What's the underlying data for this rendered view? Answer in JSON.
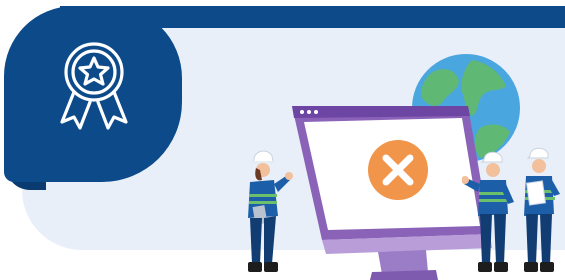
{
  "illustration": {
    "badge_icon": "award-ribbon-star-icon",
    "status_icon": "close-x-icon",
    "colors": {
      "navy": "#0c4a8a",
      "panel": "#e9eff8",
      "monitor": "#8a62b8",
      "error": "#f0954a",
      "globe_water": "#4aa6df",
      "globe_land": "#5fb874"
    }
  }
}
